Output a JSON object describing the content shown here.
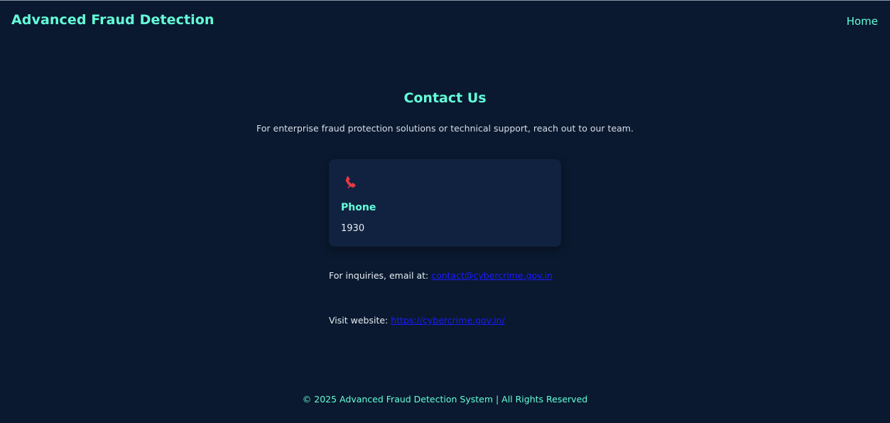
{
  "header": {
    "brand": "Advanced Fraud Detection",
    "nav": {
      "home_label": "Home"
    }
  },
  "main": {
    "title": "Contact Us",
    "intro": "For enterprise fraud protection solutions or technical support, reach out to our team.",
    "card": {
      "icon": "phone-icon",
      "title": "Phone",
      "value": "1930"
    },
    "email": {
      "prefix": "For inquiries, email at:",
      "link": "contact@cybercrime.gov.in"
    },
    "website": {
      "prefix": "Visit website:",
      "link": "https://cybercrime.gov.in/"
    }
  },
  "footer": {
    "text": "© 2025 Advanced Fraud Detection System | All Rights Reserved"
  },
  "colors": {
    "background": "#0a192f",
    "card": "#112240",
    "accent": "#64ffda",
    "link": "#1a1aff",
    "icon": "#e63946"
  }
}
